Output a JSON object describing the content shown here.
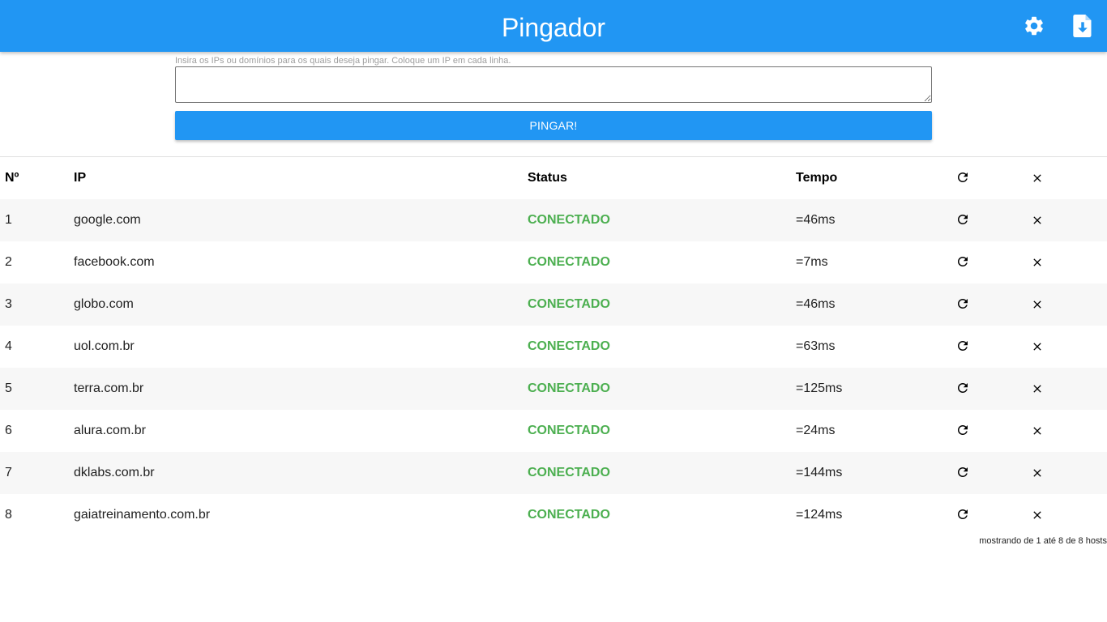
{
  "app": {
    "title": "Pingador",
    "accent_color": "#2196f3",
    "icons": {
      "settings": "gear-icon",
      "download": "file-download-icon"
    }
  },
  "form": {
    "hint": "Insira os IPs ou domínios para os quais deseja pingar. Coloque um IP em cada linha.",
    "textarea_value": "",
    "button_label": "PINGAR!"
  },
  "table": {
    "headers": {
      "number": "Nº",
      "ip": "IP",
      "status": "Status",
      "time": "Tempo"
    },
    "header_icons": {
      "refresh": "refresh-icon",
      "remove": "close-icon"
    },
    "status_color": "#4caf50",
    "rows": [
      {
        "n": "1",
        "ip": "google.com",
        "status": "CONECTADO",
        "time": "=46ms"
      },
      {
        "n": "2",
        "ip": "facebook.com",
        "status": "CONECTADO",
        "time": "=7ms"
      },
      {
        "n": "3",
        "ip": "globo.com",
        "status": "CONECTADO",
        "time": "=46ms"
      },
      {
        "n": "4",
        "ip": "uol.com.br",
        "status": "CONECTADO",
        "time": "=63ms"
      },
      {
        "n": "5",
        "ip": "terra.com.br",
        "status": "CONECTADO",
        "time": "=125ms"
      },
      {
        "n": "6",
        "ip": "alura.com.br",
        "status": "CONECTADO",
        "time": "=24ms"
      },
      {
        "n": "7",
        "ip": "dklabs.com.br",
        "status": "CONECTADO",
        "time": "=144ms"
      },
      {
        "n": "8",
        "ip": "gaiatreinamento.com.br",
        "status": "CONECTADO",
        "time": "=124ms"
      }
    ]
  },
  "footer": {
    "count_text": "mostrando de 1 até 8 de 8 hosts"
  }
}
